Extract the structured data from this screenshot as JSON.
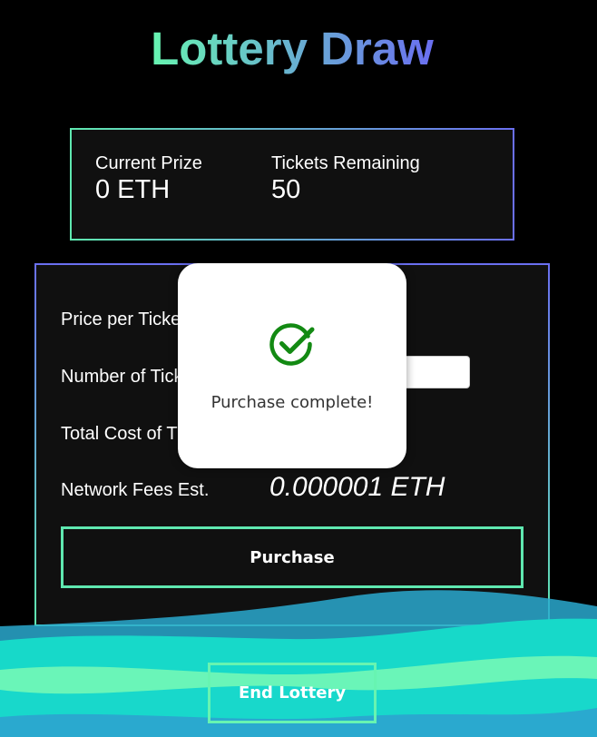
{
  "app": {
    "title": "Lottery Draw"
  },
  "stats": {
    "current_prize": {
      "label": "Current Prize",
      "value": "0 ETH"
    },
    "tickets_remaining": {
      "label": "Tickets Remaining",
      "value": "50"
    }
  },
  "form": {
    "price_label": "Price per Ticke",
    "tickets_label": "Number of Tick",
    "total_label": "Total Cost of T",
    "fees_label": "Network Fees Est.",
    "fees_value": "0.000001 ETH",
    "ticket_input_value": "",
    "purchase_label": "Purchase"
  },
  "end_lottery_label": "End Lottery",
  "modal": {
    "icon": "check-circle-icon",
    "message": "Purchase complete!",
    "icon_color": "#138a13"
  },
  "colors": {
    "accent_green": "#67f4b1",
    "accent_blue": "#6a6ff0",
    "wave_teal": "#17d9c9",
    "wave_blue": "#2aa9cf"
  }
}
